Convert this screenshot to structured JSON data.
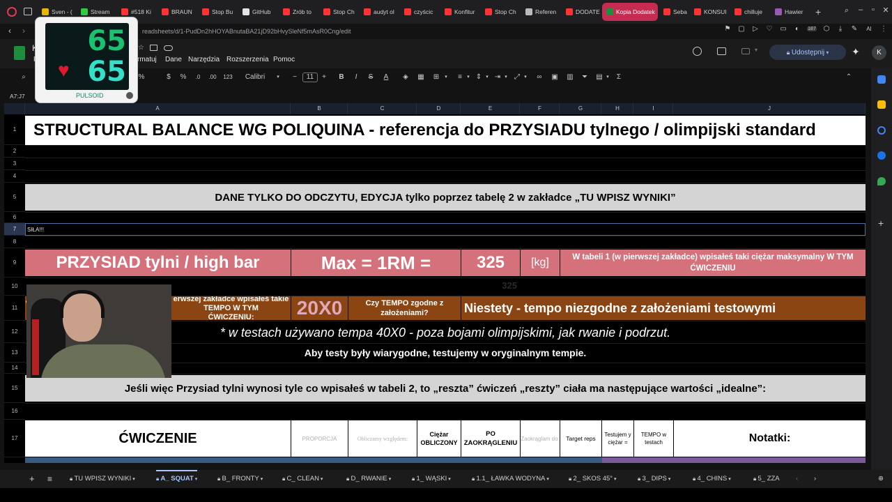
{
  "browser": {
    "tabs": [
      {
        "label": "Sven - (",
        "color": "#e8b500"
      },
      {
        "label": "Stream",
        "color": "#2ecc40"
      },
      {
        "label": "#518 Ki",
        "color": "#ff3333"
      },
      {
        "label": "BRAUN",
        "color": "#ff3333"
      },
      {
        "label": "Stop Bu",
        "color": "#ff3333"
      },
      {
        "label": "GitHub",
        "color": "#e3e3e3"
      },
      {
        "label": "Zrób to",
        "color": "#ff3333"
      },
      {
        "label": "Stop Ch",
        "color": "#ff3333"
      },
      {
        "label": "audyt ol",
        "color": "#ff3333"
      },
      {
        "label": "czyścic",
        "color": "#ff3333"
      },
      {
        "label": "Konfitur",
        "color": "#ff3333"
      },
      {
        "label": "Stop Ch",
        "color": "#ff3333"
      },
      {
        "label": "Referen",
        "color": "#bbbbbb"
      },
      {
        "label": "DODATE",
        "color": "#ff3333"
      },
      {
        "label": "Kopia Dodatek",
        "color": "#1e8e3e"
      },
      {
        "label": "Seba Su",
        "color": "#ff3333"
      },
      {
        "label": "KONSUI",
        "color": "#ff3333"
      },
      {
        "label": "chilluje",
        "color": "#ff3333"
      },
      {
        "label": "Hawier",
        "color": "#9b59b6"
      }
    ],
    "new_tab": "+",
    "url": "readsheets/d/1-PudDn2hHOYABnutaBA21jD92bHvySleNf5mAsR0Cng/edit",
    "badge": "187",
    "ai_label": "AI"
  },
  "sheets": {
    "title_partial": "K",
    "menu": [
      "F",
      "rmatuj",
      "Dane",
      "Narzędzia",
      "Rozszerzenia",
      "Pomoc"
    ],
    "share_label": "Udostępnij",
    "avatar": "K",
    "toolbar": {
      "zoom_partial": "%",
      "currency": "$",
      "percent": "%",
      "dec_less": ".0",
      "dec_more": ".00",
      "number_fmt": "123",
      "font": "Calibri",
      "font_size": "11",
      "minus": "−",
      "plus": "+",
      "bold": "B",
      "italic": "I",
      "strike": "S",
      "textcolor": "A",
      "sigma": "Σ"
    },
    "namebox": "A7:J7",
    "columns": [
      "A",
      "B",
      "C",
      "D",
      "E",
      "F",
      "G",
      "H",
      "I",
      "J"
    ]
  },
  "rows": {
    "r1": "STRUCTURAL BALANCE WG POLIQUINA - referencja do PRZYSIADU tylnego / olimpijski standard",
    "r5": "DANE TYLKO DO ODCZYTU, EDYCJA tylko poprzez tabelę 2 w zakładce „TU WPISZ WYNIKI”",
    "r7": "SIŁA!!!",
    "r9_exercise": "PRZYSIAD tylni / high bar",
    "r9_max": "Max = 1RM =",
    "r9_value": "325",
    "r9_unit": "[kg]",
    "r9_note": "W tabeli 1 (w pierwszej zakładce) wpisałeś taki ciężar maksymalny W TYM ĆWICZENIU",
    "r10_ghost": "325",
    "r11_tempo_label": "W tabeli 1 (w pierwszej zakładce wpisałeś takie TEMPO W TYM ĆWICZENIU:",
    "r11_tempo_label_visible": "W",
    "r11_tempo_label_rest": "erwszej zakładce wpisałeś takie TEMPO W TYM",
    "r11_tempo_label_line2": "ĆWICZENIU:",
    "r11_tempo": "20X0",
    "r11_question": "Czy TEMPO zgodne z założeniami?",
    "r11_answer": "Niestety -   tempo niezgodne z założeniami testowymi",
    "r12": "* w testach używano tempa 40X0 - poza bojami olimpijskimi, jak rwanie i podrzut.",
    "r13": "Aby testy były wiarygodne, testujemy w oryginalnym tempie.",
    "r15": "Jeśli więc Przysiad tylni wynosi tyle co wpisałeś w tabeli 2, to „reszta” ćwiczeń „reszty” ciała ma następujące wartości „idealne”:",
    "r17": {
      "exercise": "ĆWICZENIE",
      "proportion": "PROPORCJA",
      "relative": "Obliczamy względem:",
      "weight_calc": "Ciężar OBLICZONY",
      "rounded": "PO ZAOKRĄGLENIU",
      "round_to": "Zaokrąglam do:",
      "target_reps": "Target reps",
      "tested_weight": "Testujem y ciężar =",
      "tempo_tests": "TEMPO w testach",
      "notes": "Notatki:"
    },
    "row_numbers": [
      "1",
      "2",
      "3",
      "4",
      "5",
      "6",
      "7",
      "8",
      "9",
      "10",
      "11",
      "12",
      "13",
      "14",
      "15",
      "16",
      "17"
    ]
  },
  "pulsoid": {
    "bpm_top": "65",
    "bpm_bottom": "65",
    "brand": "PULSOID"
  },
  "sheet_tabs": [
    "TU WPISZ WYNIKI",
    "A_ SQUAT",
    "B_ FRONTY",
    "C_ CLEAN",
    "D_ RWANIE",
    "1_ WĄSKI",
    "1.1_ ŁAWKA WODYNA",
    "2_ SKOS 45°",
    "3_ DIPS",
    "4_ CHINS",
    "5_ ZZA"
  ],
  "colors": {
    "pink": "#d4717a",
    "brown": "#8b4513",
    "gray": "#d4d4d4",
    "active_tab": "#c62c52"
  }
}
